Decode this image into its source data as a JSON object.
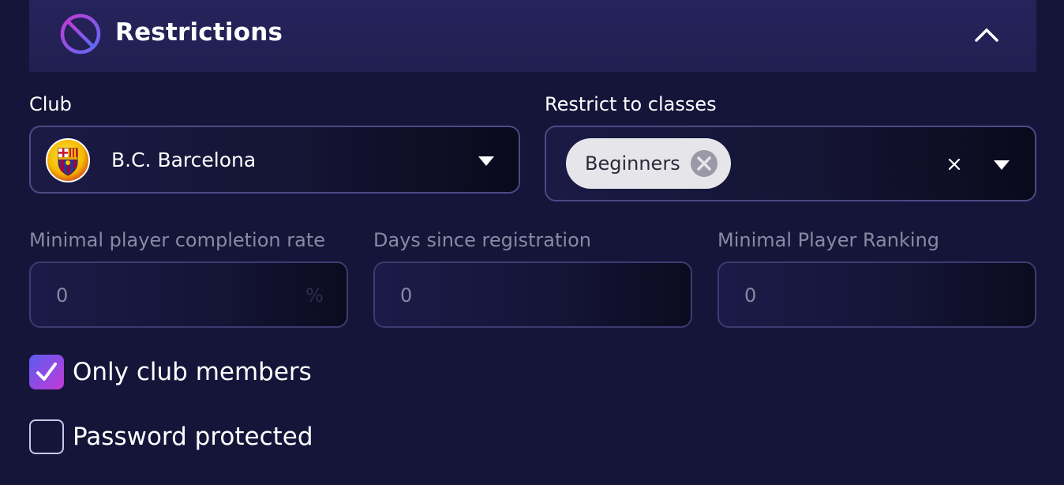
{
  "section": {
    "title": "Restrictions",
    "icon": "ban-icon",
    "toggle_icon": "chevron-up-icon"
  },
  "club": {
    "label": "Club",
    "selected": "B.C. Barcelona",
    "crest_icon": "club-crest-icon"
  },
  "classes": {
    "label": "Restrict to classes",
    "chips": [
      {
        "label": "Beginners"
      }
    ]
  },
  "fields": {
    "completion_rate": {
      "label": "Minimal player completion rate",
      "value": "0",
      "suffix": "%"
    },
    "days_since_registration": {
      "label": "Days since registration",
      "value": "0"
    },
    "minimal_ranking": {
      "label": "Minimal Player Ranking",
      "value": "0"
    }
  },
  "options": {
    "only_club_members": {
      "label": "Only club members",
      "checked": true
    },
    "password_protected": {
      "label": "Password protected",
      "checked": false
    }
  },
  "colors": {
    "background": "#15153a",
    "header": "#25235a",
    "accent_start": "#5b5cf0",
    "accent_end": "#c23ad6",
    "muted_text": "#8a89a3"
  }
}
